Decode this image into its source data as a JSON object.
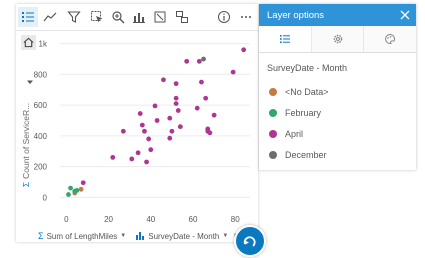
{
  "chart_toolbar": {
    "icons": [
      "legend-icon",
      "trend-line-icon",
      "filter-icon",
      "selection-icon",
      "zoom-icon",
      "chart-type-icon",
      "maximize-icon",
      "flip-card-icon",
      "info-icon",
      "more-icon"
    ]
  },
  "chart": {
    "y_axis_label": "Count of ServiceR...",
    "x_field_label": "Sum of LengthMiles",
    "color_field_label": "SurveyDate - Month"
  },
  "chart_data": {
    "type": "scatter",
    "x_ticks": [
      "0",
      "20",
      "40",
      "60",
      "80"
    ],
    "y_ticks": [
      "0",
      "200",
      "400",
      "600",
      "800",
      "1k"
    ],
    "xlim": [
      -3,
      87
    ],
    "ylim": [
      -50,
      1050
    ],
    "series": [
      {
        "name": "<No Data>",
        "color": "#c37b45",
        "points": [
          [
            4,
            28
          ],
          [
            7,
            52
          ]
        ]
      },
      {
        "name": "February",
        "color": "#35a56e",
        "points": [
          [
            1,
            18
          ],
          [
            2,
            60
          ],
          [
            4,
            40
          ],
          [
            5,
            45
          ]
        ]
      },
      {
        "name": "April",
        "color": "#ae3594",
        "points": [
          [
            8,
            95
          ],
          [
            22,
            260
          ],
          [
            27,
            430
          ],
          [
            31,
            250
          ],
          [
            34,
            290
          ],
          [
            35,
            545
          ],
          [
            36,
            470
          ],
          [
            37,
            430
          ],
          [
            38,
            230
          ],
          [
            39,
            380
          ],
          [
            40,
            310
          ],
          [
            42,
            595
          ],
          [
            43,
            500
          ],
          [
            46,
            765
          ],
          [
            49,
            515
          ],
          [
            49,
            385
          ],
          [
            50,
            430
          ],
          [
            52,
            610
          ],
          [
            52,
            740
          ],
          [
            52,
            645
          ],
          [
            53,
            565
          ],
          [
            54,
            460
          ],
          [
            57,
            885
          ],
          [
            62,
            580
          ],
          [
            63,
            885
          ],
          [
            64,
            750
          ],
          [
            66,
            645
          ],
          [
            67,
            445
          ],
          [
            67,
            430
          ],
          [
            68,
            420
          ],
          [
            70,
            535
          ],
          [
            79,
            815
          ],
          [
            84,
            960
          ]
        ]
      },
      {
        "name": "December",
        "color": "#6e6e6e",
        "points": [
          [
            65,
            900
          ]
        ]
      }
    ]
  },
  "panel": {
    "title": "Layer options",
    "section_title": "SurveyDate - Month",
    "legend": [
      {
        "label": "<No Data>",
        "color": "#c37b45"
      },
      {
        "label": "February",
        "color": "#35a56e"
      },
      {
        "label": "April",
        "color": "#ae3594"
      },
      {
        "label": "December",
        "color": "#6e6e6e"
      }
    ]
  }
}
